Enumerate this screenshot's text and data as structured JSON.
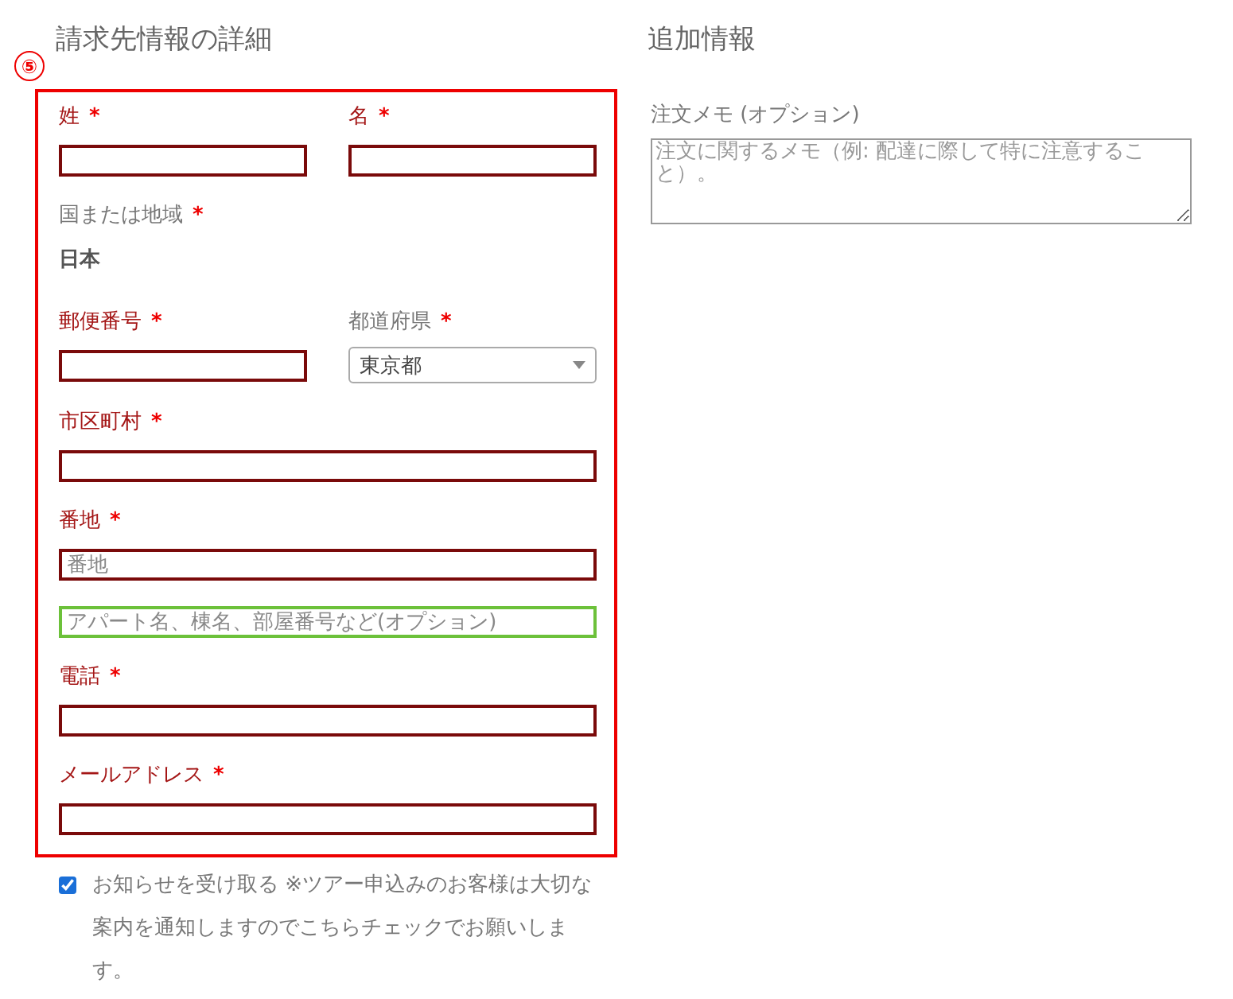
{
  "billing": {
    "title": "請求先情報の詳細",
    "annotation": "⑤",
    "rows": [
      {
        "fields": [
          {
            "kind": "text",
            "label": "姓",
            "required_mark": "*",
            "invalid": true,
            "inputs": [
              {
                "invalid": true
              }
            ]
          },
          {
            "kind": "text",
            "label": "名",
            "required_mark": "*",
            "invalid": true,
            "inputs": [
              {
                "invalid": true
              }
            ]
          }
        ]
      },
      {
        "fields": [
          {
            "kind": "static",
            "label": "国または地域",
            "required_mark": "*",
            "invalid": false,
            "value": "日本"
          }
        ]
      },
      {
        "fields": [
          {
            "kind": "text",
            "label": "郵便番号",
            "required_mark": "*",
            "invalid": true,
            "inputs": [
              {
                "invalid": true
              }
            ]
          },
          {
            "kind": "select",
            "label": "都道府県",
            "required_mark": "*",
            "invalid": false,
            "value": "東京都"
          }
        ]
      },
      {
        "fields": [
          {
            "kind": "text",
            "label": "市区町村",
            "required_mark": "*",
            "invalid": true,
            "inputs": [
              {
                "invalid": true
              }
            ]
          }
        ]
      },
      {
        "fields": [
          {
            "kind": "text",
            "label": "番地",
            "required_mark": "*",
            "invalid": true,
            "inputs": [
              {
                "invalid": true,
                "placeholder": "番地"
              },
              {
                "invalid": false,
                "placeholder": "アパート名、棟名、部屋番号など(オプション)"
              }
            ]
          }
        ]
      },
      {
        "fields": [
          {
            "kind": "text",
            "label": "電話",
            "required_mark": "*",
            "invalid": true,
            "inputs": [
              {
                "invalid": true
              }
            ]
          }
        ]
      },
      {
        "fields": [
          {
            "kind": "text",
            "label": "メールアドレス",
            "required_mark": "*",
            "invalid": true,
            "inputs": [
              {
                "invalid": true
              }
            ]
          }
        ]
      }
    ],
    "newsletter": {
      "checked": true,
      "text": "お知らせを受け取る ※ツアー申込みのお客様は大切な案内を通知しますのでこちらチェックでお願いします。"
    }
  },
  "additional": {
    "title": "追加情報",
    "note_label": "注文メモ (オプション)",
    "note_placeholder": "注文に関するメモ（例: 配達に際して特に注意すること）。"
  }
}
